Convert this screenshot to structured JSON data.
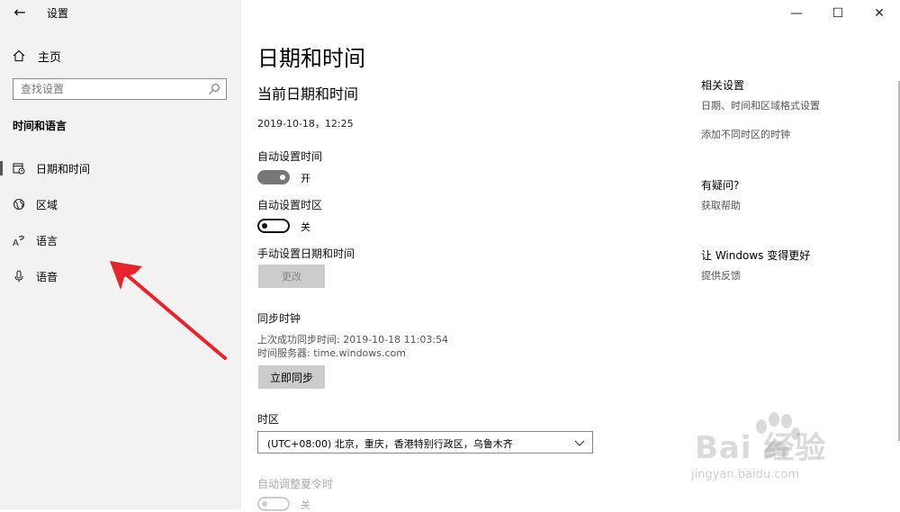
{
  "sidebar": {
    "app_title": "设置",
    "home_label": "主页",
    "search_placeholder": "查找设置",
    "section_title": "时间和语言",
    "items": [
      {
        "label": "日期和时间",
        "icon": "calendar-clock-icon",
        "active": true
      },
      {
        "label": "区域",
        "icon": "globe-icon",
        "active": false
      },
      {
        "label": "语言",
        "icon": "language-icon",
        "active": false
      },
      {
        "label": "语音",
        "icon": "microphone-icon",
        "active": false
      }
    ]
  },
  "window_controls": [
    "—",
    "☐",
    "✕"
  ],
  "main": {
    "title": "日期和时间",
    "current_section": "当前日期和时间",
    "current_datetime": "2019-10-18，12:25",
    "auto_time": {
      "label": "自动设置时间",
      "state_text": "开",
      "on": true
    },
    "auto_timezone": {
      "label": "自动设置时区",
      "state_text": "关",
      "on": false
    },
    "manual": {
      "label": "手动设置日期和时间",
      "button": "更改"
    },
    "sync": {
      "title": "同步时钟",
      "last_sync": "上次成功同步时间: 2019-10-18 11:03:54",
      "server": "时间服务器: time.windows.com",
      "button": "立即同步"
    },
    "timezone": {
      "label": "时区",
      "value": "(UTC+08:00) 北京，重庆，香港特别行政区，乌鲁木齐"
    },
    "dst": {
      "label": "自动调整夏令时",
      "state_text": "关"
    }
  },
  "aside": {
    "related_title": "相关设置",
    "related_links": [
      "日期、时间和区域格式设置",
      "添加不同时区的时钟"
    ],
    "question_title": "有疑问?",
    "help_link": "获取帮助",
    "improve_title": "让 Windows 变得更好",
    "feedback_link": "提供反馈"
  },
  "watermark": {
    "brand": "Bai 经验",
    "url": "jingyan.baidu.com"
  },
  "colors": {
    "annotation_arrow": "#e8232a",
    "sidebar_bg": "#f2f2f2",
    "toggle_on": "#777777"
  }
}
